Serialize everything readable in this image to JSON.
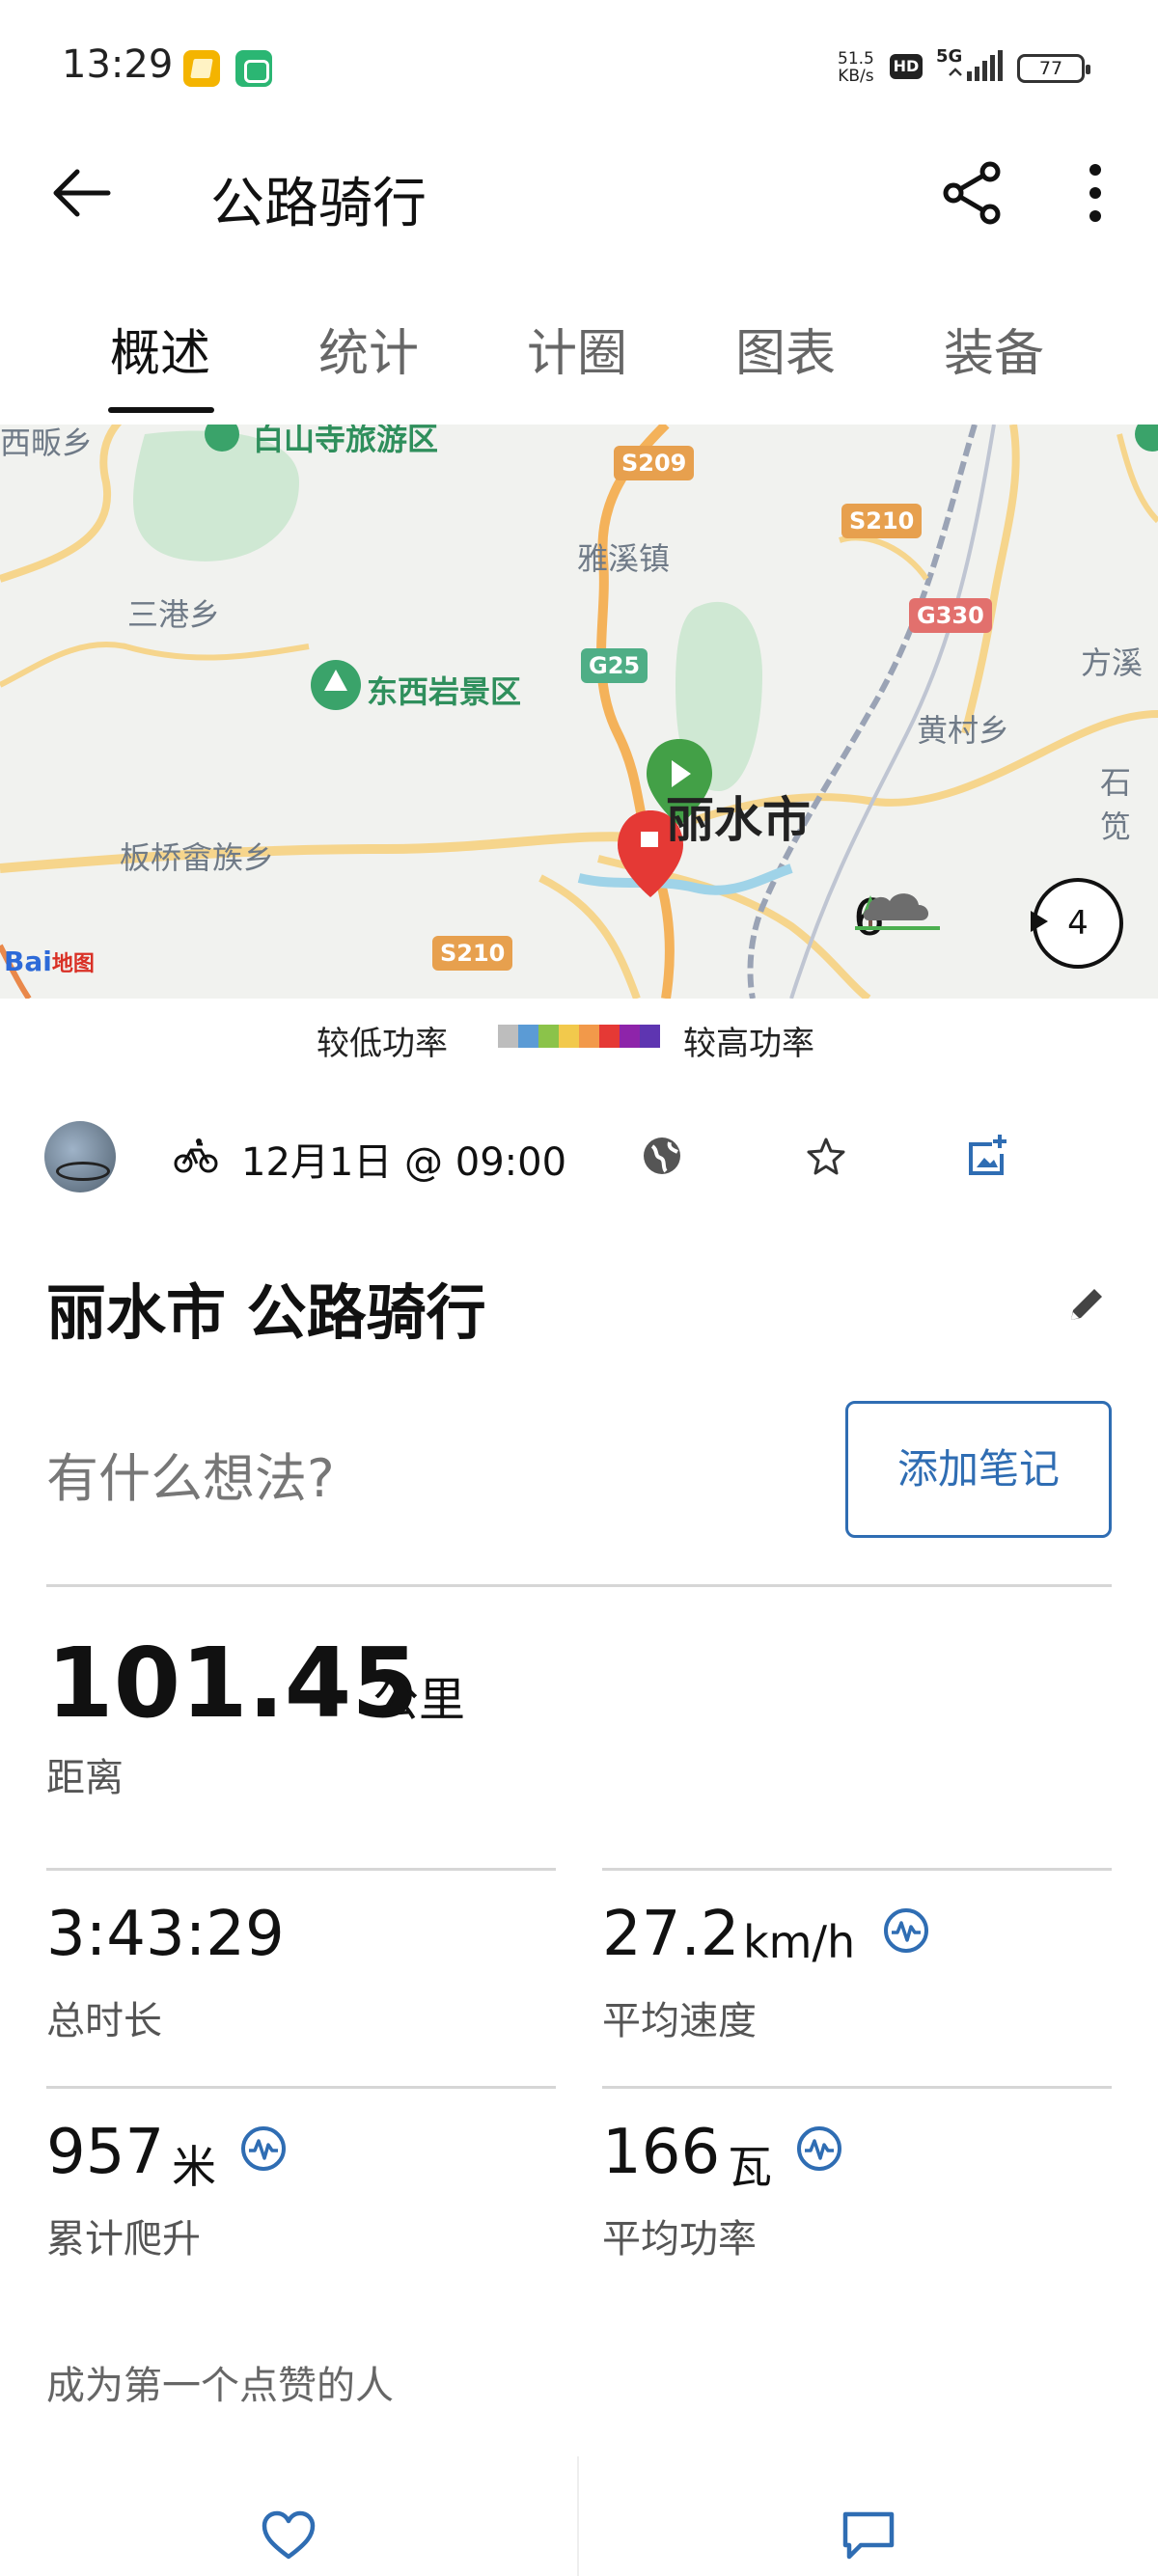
{
  "status_bar": {
    "time": "13:29",
    "net_speed_top": "51.5",
    "net_speed_bottom": "KB/s",
    "hd": "HD",
    "network": "5G",
    "battery": "77"
  },
  "header": {
    "title": "公路骑行",
    "back_icon": "arrow-left-icon",
    "share_icon": "share-icon",
    "more_icon": "more-vert-icon"
  },
  "tabs": [
    {
      "label": "概述",
      "active": true
    },
    {
      "label": "统计",
      "active": false
    },
    {
      "label": "计圈",
      "active": false
    },
    {
      "label": "图表",
      "active": false
    },
    {
      "label": "装备",
      "active": false
    }
  ],
  "map": {
    "labels": {
      "top_left": "西畈乡",
      "scenic_top": "白山寺旅游区",
      "town1": "雅溪镇",
      "town2": "三港乡",
      "scenic2": "东西岩景区",
      "town3": "黄村乡",
      "town4": "方溪",
      "town5": "石笕",
      "town6": "板桥畲族乡",
      "city": "丽水市"
    },
    "shields": {
      "s209": "S209",
      "s210_top": "S210",
      "g330": "G330",
      "g25": "G25",
      "s210_bottom": "S210"
    },
    "weather": {
      "temperature": "6°",
      "icon": "cloud-tree-icon",
      "wind": "4"
    },
    "logo": "Bai",
    "logo_tail": "地图"
  },
  "power_legend": {
    "low": "较低功率",
    "high": "较高功率",
    "colors": [
      "#bdbdbd",
      "#5b9bd5",
      "#8bc34a",
      "#f2c94c",
      "#f2994a",
      "#e53935",
      "#8e24aa",
      "#5e35b1"
    ]
  },
  "activity": {
    "date": "12月1日 @ 09:00",
    "title": "丽水市 公路骑行",
    "note_prompt": "有什么想法?",
    "add_note": "添加笔记"
  },
  "stats": {
    "distance": {
      "value": "101.45",
      "unit": "公里",
      "label": "距离"
    },
    "duration": {
      "value": "3:43:29",
      "label": "总时长"
    },
    "avg_speed": {
      "value": "27.2",
      "unit": "km/h",
      "label": "平均速度"
    },
    "elevation": {
      "value": "957",
      "unit": "米",
      "label": "累计爬升"
    },
    "avg_power": {
      "value": "166",
      "unit": "瓦",
      "label": "平均功率"
    }
  },
  "social": {
    "first_like": "成为第一个点赞的人"
  },
  "colors": {
    "accent": "#2f6db3",
    "divider": "#d6d6d6"
  }
}
